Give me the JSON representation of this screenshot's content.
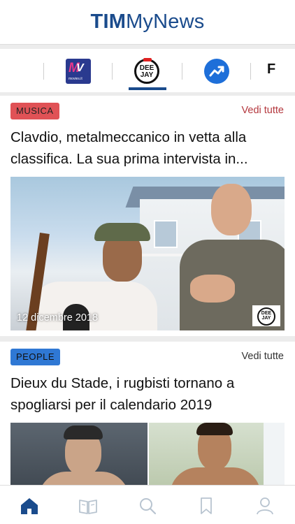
{
  "app": {
    "title_bold": "TIM",
    "title_regular": "MyNews"
  },
  "sources": {
    "items": [
      {
        "name": "MoviesIt",
        "logo_big": "M",
        "logo_overlay": "V",
        "logo_small": "movies.it"
      },
      {
        "name": "Radio Deejay",
        "line1": "DEE",
        "line2": "JAY",
        "selected": true
      },
      {
        "name": "Trend",
        "icon": "trend-up-icon"
      },
      {
        "name": "Partial source",
        "letter": "F"
      }
    ]
  },
  "cards": [
    {
      "category": "MUSICA",
      "see_all": "Vedi tutte",
      "headline": "Clavdio, metalmeccanico in vetta alla classifica. La sua prima intervista in...",
      "date": "12 dicembre 2018",
      "watermark_line1": "DEE",
      "watermark_line2": "JAY",
      "badge_color": "#e05256"
    },
    {
      "category": "PEOPLE",
      "see_all": "Vedi tutte",
      "headline": "Dieux du Stade, i rugbisti tornano a spogliarsi per il calendario 2019",
      "badge_color": "#2f78d4"
    }
  ],
  "nav": {
    "items": [
      {
        "icon": "home-icon",
        "active": true
      },
      {
        "icon": "book-icon"
      },
      {
        "icon": "search-icon"
      },
      {
        "icon": "bookmark-icon"
      },
      {
        "icon": "profile-icon"
      }
    ],
    "active_color": "#1a4b8c",
    "inactive_color": "#b8c4d0"
  },
  "colors": {
    "brand": "#1a4b8c",
    "see_all_red": "#b4383e"
  }
}
